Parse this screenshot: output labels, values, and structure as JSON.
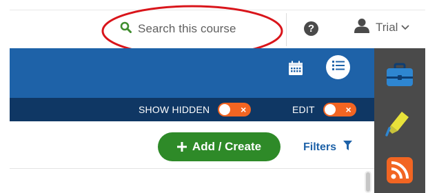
{
  "header": {
    "search_label": "Search this course",
    "help_glyph": "?",
    "user_name": "Trial",
    "icons": [
      "search-icon",
      "help-icon",
      "user-icon",
      "chevron-down-icon"
    ]
  },
  "toolbar": {
    "icons": [
      "calendar-icon",
      "list-view-icon"
    ]
  },
  "toggles": {
    "show_hidden_label": "SHOW HIDDEN",
    "show_hidden_state": "×",
    "edit_label": "EDIT",
    "edit_state": "×"
  },
  "actions": {
    "add_label": "Add / Create",
    "filters_label": "Filters"
  },
  "sidebar": {
    "icons": [
      "briefcase-icon",
      "highlighter-icon",
      "rss-icon"
    ]
  },
  "colors": {
    "primary_blue": "#1e62a8",
    "navy": "#0f3764",
    "green": "#2e8a28",
    "orange": "#f26522",
    "sidebar_gray": "#4a4a4a",
    "annotation_red": "#d9151b"
  }
}
